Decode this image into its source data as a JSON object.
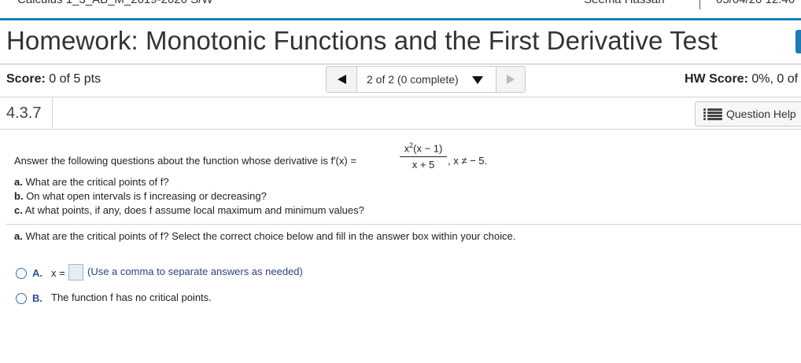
{
  "top_strip": {
    "left_text": "Calculus 1_3_AB_M_2019-2020 S/W",
    "right_text": "Seema Hassan",
    "date_text": "05/04/20 12:46"
  },
  "header": {
    "title": "Homework: Monotonic Functions and the First Derivative Test"
  },
  "score": {
    "label": "Score:",
    "value": "0 of 5 pts"
  },
  "navigator": {
    "position_text": "2 of 2 (0 complete)"
  },
  "hw_score": {
    "label": "HW Score:",
    "value": "0%, 0 of"
  },
  "question": {
    "number": "4.3.7",
    "help_label": "Question Help",
    "prompt_lead": "Answer the following questions about the function whose derivative is f′(x) =",
    "numerator_base": "x",
    "numerator_exp": "2",
    "numerator_rest": "(x − 1)",
    "denominator": "x + 5",
    "condition": ", x ≠ − 5.",
    "parts": [
      {
        "letter": "a.",
        "text": "What are the critical points of f?"
      },
      {
        "letter": "b.",
        "text": "On what open intervals is f increasing or decreasing?"
      },
      {
        "letter": "c.",
        "text": "At what points, if any, does f assume local maximum and minimum values?"
      }
    ]
  },
  "part_a": {
    "letter": "a.",
    "text": "What are the critical points of f? Select the correct choice below and fill in the answer box within your choice."
  },
  "choices": {
    "a": {
      "letter": "A.",
      "prefix": "x =",
      "answer_value": "",
      "hint": "(Use a comma to separate answers as needed)"
    },
    "b": {
      "letter": "B.",
      "text": "The function f has no critical points."
    }
  },
  "colors": {
    "accent": "#1f7bb6",
    "choice_letter": "#2a4f8f",
    "hint_text": "#2a3f8a"
  }
}
